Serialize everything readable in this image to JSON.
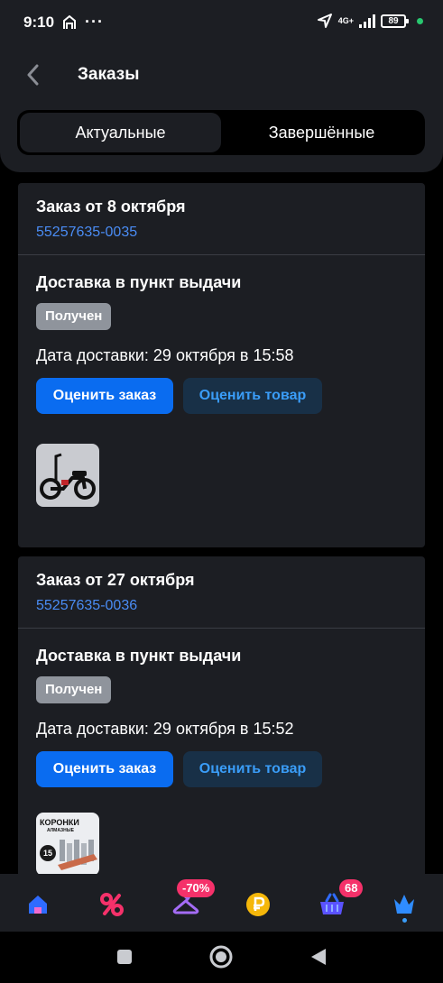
{
  "status_bar": {
    "time": "9:10",
    "network": "4G+",
    "battery": "89"
  },
  "header": {
    "title": "Заказы"
  },
  "tabs": [
    {
      "label": "Актуальные"
    },
    {
      "label": "Завершённые"
    }
  ],
  "orders": [
    {
      "title": "Заказ от 8 октября",
      "number": "55257635-0035",
      "delivery_type": "Доставка в пункт выдачи",
      "status": "Получен",
      "delivery_date": "Дата доставки: 29 октября в 15:58",
      "rate_order_label": "Оценить заказ",
      "rate_product_label": "Оценить товар"
    },
    {
      "title": "Заказ от 27 октября",
      "number": "55257635-0036",
      "delivery_type": "Доставка в пункт выдачи",
      "status": "Получен",
      "delivery_date": "Дата доставки: 29 октября в 15:52",
      "rate_order_label": "Оценить заказ",
      "rate_product_label": "Оценить товар",
      "product_thumb_text": {
        "title": "КОРОНКИ",
        "subtitle": "АЛМАЗНЫЕ",
        "count": "15"
      }
    }
  ],
  "bottom_nav": {
    "items": [
      {
        "icon": "home-icon"
      },
      {
        "icon": "percent-icon"
      },
      {
        "icon": "hanger-icon",
        "badge": "-70%"
      },
      {
        "icon": "ruble-coin-icon"
      },
      {
        "icon": "basket-icon",
        "badge": "68"
      },
      {
        "icon": "crown-icon"
      }
    ]
  },
  "colors": {
    "accent": "#0a6cf0",
    "link": "#4a8cf4",
    "badge": "#f5316a",
    "card": "#1c1e23"
  }
}
